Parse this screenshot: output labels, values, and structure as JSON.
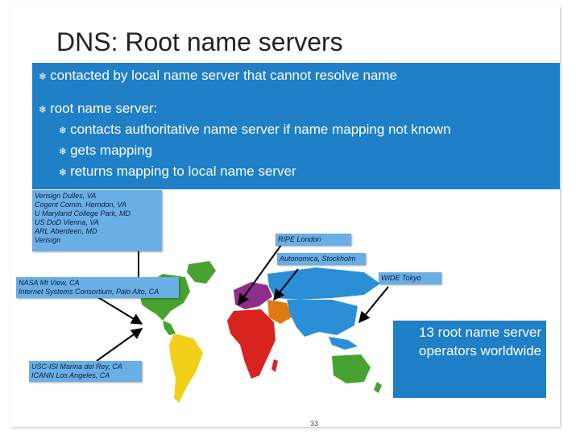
{
  "slide": {
    "title": "DNS: Root name servers",
    "bullets": [
      "contacted by local name server that cannot resolve name",
      "root name server:"
    ],
    "sub_bullets": [
      "contacts authoritative name server if name mapping not known",
      "gets mapping",
      "returns mapping to local name server"
    ],
    "labels": {
      "verisign": [
        "Verisign Dulles, VA",
        "Cogent Comm. Herndon, VA",
        "U Maryland College Park, MD",
        "US DoD Vienna, VA",
        "ARL Aberdeen, MD",
        "Verisign"
      ],
      "ripe": "RIPE London",
      "autonomica": "Autonomica, Stockholm",
      "wide": "WIDE Tokyo",
      "nasa": [
        "NASA Mt View, CA",
        "Internet Systems Consortium, Palo Alto, CA"
      ],
      "usc": [
        "USC-ISI Marina del Rey, CA",
        "ICANN Los Angeles, CA"
      ]
    },
    "callout": "13 root name server operators worldwide",
    "page_number": "33",
    "bullet_glyph": "❄"
  }
}
